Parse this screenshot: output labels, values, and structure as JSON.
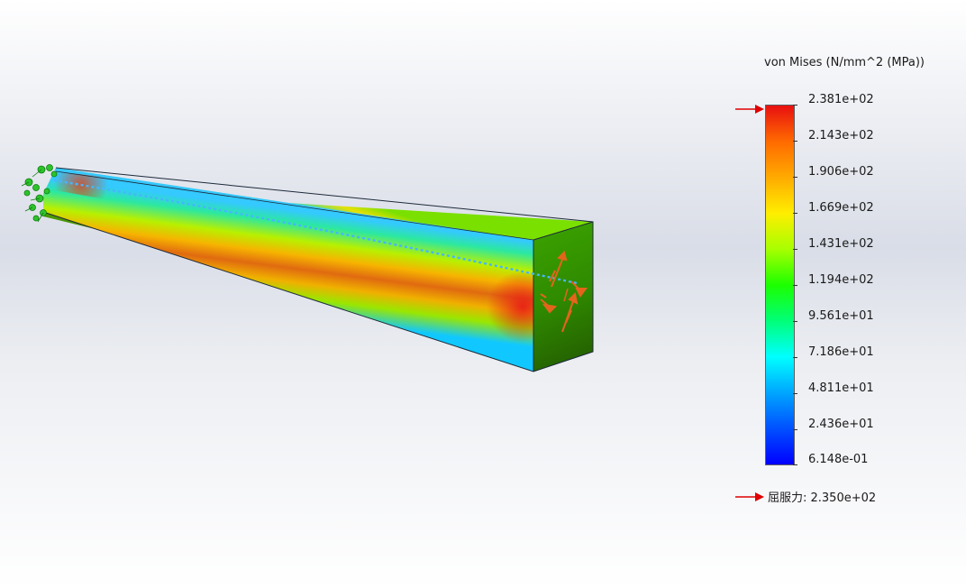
{
  "legend": {
    "title": "von Mises (N/mm^2 (MPa))",
    "ticks": [
      "2.381e+02",
      "2.143e+02",
      "1.906e+02",
      "1.669e+02",
      "1.431e+02",
      "1.194e+02",
      "9.561e+01",
      "7.186e+01",
      "4.811e+01",
      "2.436e+01",
      "6.148e-01"
    ],
    "colors": {
      "max": "#e81010",
      "mid": "#1cff00",
      "min": "#0000ff"
    }
  },
  "yield": {
    "label": "屈服力: 2.350e+02",
    "arrow_color": "#e00000"
  },
  "icons": {
    "fixture": "fixture-green-arrows-icon",
    "load": "load-orange-arrows-icon",
    "marker": "red-arrow-icon"
  }
}
